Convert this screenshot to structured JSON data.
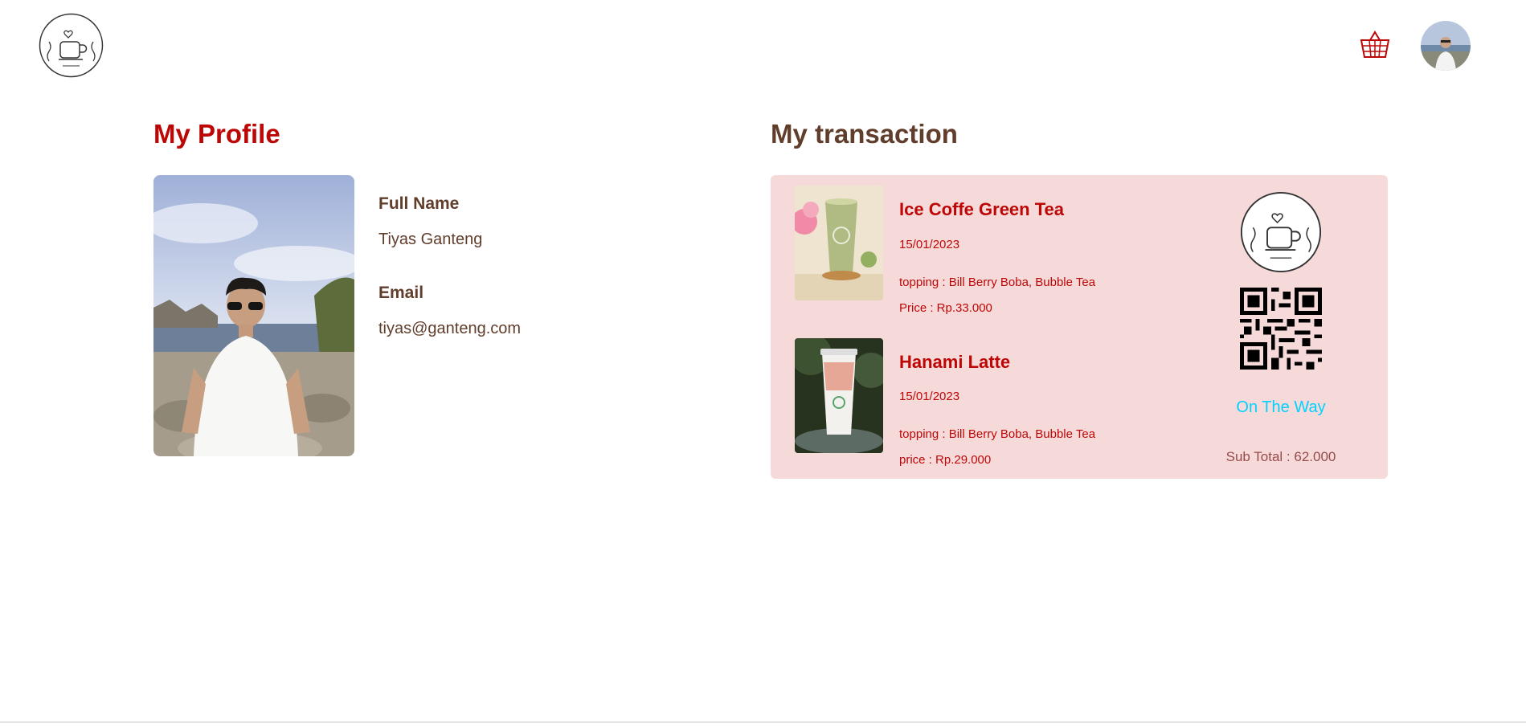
{
  "colors": {
    "brand_red": "#BD0707",
    "brand_brown": "#613D2B",
    "card_bg": "#F6DADA",
    "status_color": "#00D1FF",
    "subtotal_color": "#974A4A"
  },
  "icons": {
    "logo": "cafe-logo-icon",
    "cart": "basket-icon",
    "avatar": "avatar"
  },
  "profile": {
    "title": "My Profile",
    "full_name_label": "Full Name",
    "full_name": "Tiyas Ganteng",
    "email_label": "Email",
    "email": "tiyas@ganteng.com"
  },
  "transaction": {
    "title": "My transaction",
    "items": [
      {
        "name": "Ice Coffe Green Tea",
        "date": "15/01/2023",
        "topping": "topping : Bill Berry Boba, Bubble Tea",
        "price": "Price : Rp.33.000"
      },
      {
        "name": "Hanami Latte",
        "date": "15/01/2023",
        "topping": "topping : Bill Berry Boba, Bubble Tea",
        "price": "price : Rp.29.000"
      }
    ],
    "status": "On The Way",
    "subtotal": "Sub Total : 62.000"
  }
}
